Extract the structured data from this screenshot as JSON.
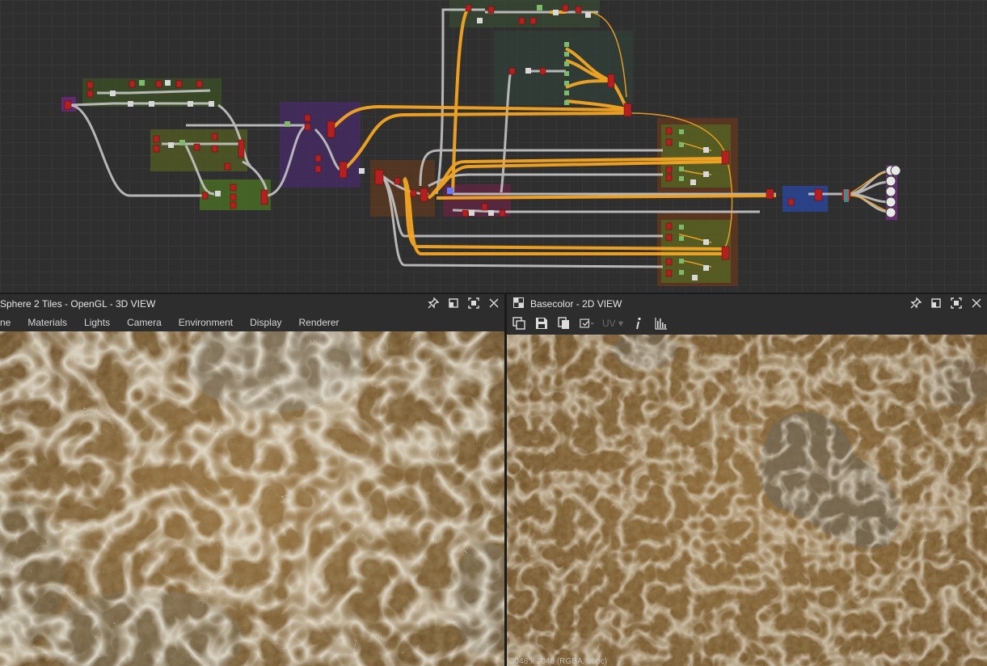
{
  "graph": {
    "name": "node graph"
  },
  "panel_3d": {
    "title": "Sphere 2 Tiles - OpenGL - 3D VIEW",
    "menu": [
      "ne",
      "Materials",
      "Lights",
      "Camera",
      "Environment",
      "Display",
      "Renderer"
    ]
  },
  "panel_2d": {
    "title": "Basecolor - 2D VIEW",
    "toolbar": {
      "uv_label": "UV"
    },
    "status": "2048 x 2048 (RGBA, 8bpc)"
  },
  "icons": [
    "pin-icon",
    "restore-icon",
    "maximize-icon",
    "close-icon",
    "graph-icon",
    "save-icon",
    "copy-icon",
    "export-icon",
    "info-icon",
    "histogram-icon",
    "checker-icon"
  ],
  "colors": {
    "connection_orange": "#f5a623",
    "connection_grey": "#c8c8c8",
    "node_red": "#b41f1f",
    "frame_green": "#4b6b2c",
    "frame_purple": "#4a2b6b",
    "frame_blue": "#2a4aa0"
  }
}
